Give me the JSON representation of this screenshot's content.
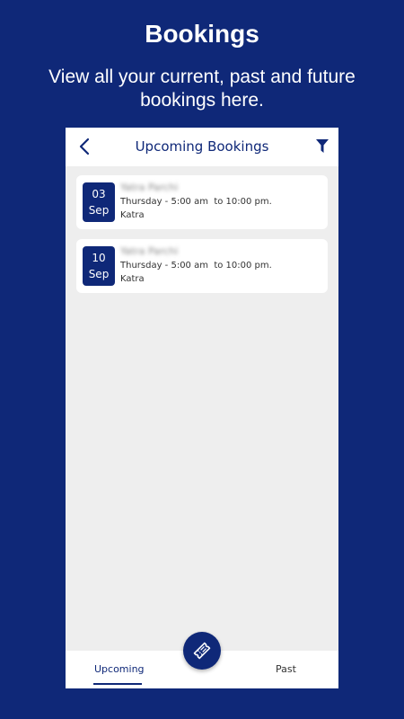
{
  "promo": {
    "title": "Bookings",
    "subtitle": "View all your current, past and future bookings here."
  },
  "header": {
    "title": "Upcoming Bookings",
    "back_icon": "chevron-left-icon",
    "filter_icon": "filter-icon"
  },
  "bookings": [
    {
      "day": "03",
      "month": "Sep",
      "name": "Yatra Parchi",
      "time": "Thursday - 5:00 am  to 10:00 pm.",
      "location": "Katra"
    },
    {
      "day": "10",
      "month": "Sep",
      "name": "Yatra Parchi",
      "time": "Thursday - 5:00 am  to 10:00 pm.",
      "location": "Katra"
    }
  ],
  "bottom_nav": {
    "upcoming_label": "Upcoming",
    "past_label": "Past",
    "fab_icon": "ticket-icon",
    "active_tab": "Upcoming"
  },
  "colors": {
    "brand": "#0f2878",
    "content_background": "#eeeeee",
    "card_background": "#ffffff"
  }
}
